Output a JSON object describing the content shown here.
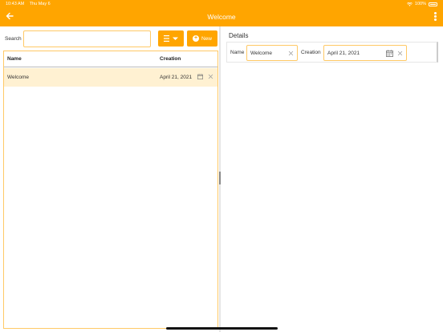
{
  "status": {
    "time": "10:43 AM",
    "date": "Thu May 6",
    "battery": "100%"
  },
  "header": {
    "title": "Welcome"
  },
  "search": {
    "label": "Search",
    "value": "",
    "placeholder": ""
  },
  "toolbar": {
    "new_label": "New"
  },
  "table": {
    "columns": [
      "Name",
      "Creation"
    ],
    "rows": [
      {
        "name": "Welcome",
        "creation": "April 21, 2021"
      }
    ]
  },
  "details": {
    "title": "Details",
    "name_label": "Name",
    "name_value": "Welcome",
    "creation_label": "Creation",
    "creation_value": "April 21, 2021"
  },
  "colors": {
    "accent": "#FFA500",
    "selected_row": "#FFF1D2",
    "field_border": "#FFC966"
  }
}
